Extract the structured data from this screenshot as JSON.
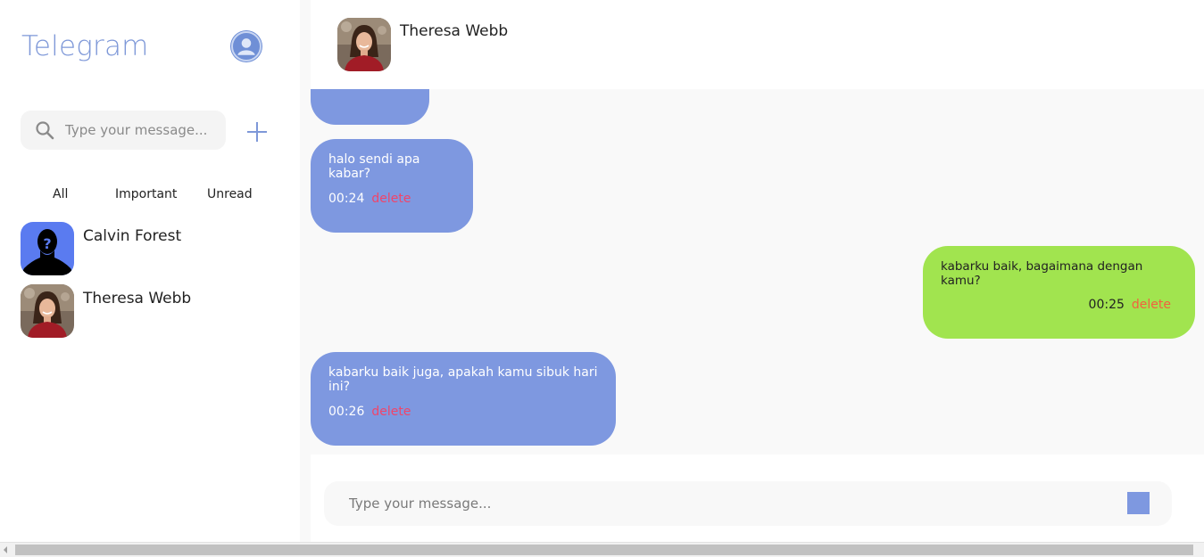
{
  "sidebar": {
    "title": "Telegram",
    "search": {
      "placeholder": "Type your message..."
    },
    "tabs": [
      {
        "label": "All"
      },
      {
        "label": "Important"
      },
      {
        "label": "Unread"
      }
    ],
    "contacts": [
      {
        "name": "Calvin Forest",
        "avatar": "unknown-person-avatar"
      },
      {
        "name": "Theresa Webb",
        "avatar": "photo-avatar"
      }
    ]
  },
  "chat": {
    "header": {
      "name": "Theresa Webb"
    },
    "messages": [
      {
        "direction": "in",
        "text": "",
        "time": "",
        "delete_label": ""
      },
      {
        "direction": "in",
        "text": "halo sendi apa kabar?",
        "time": "00:24",
        "delete_label": "delete"
      },
      {
        "direction": "out",
        "text": "kabarku baik, bagaimana dengan kamu?",
        "time": "00:25",
        "delete_label": "delete"
      },
      {
        "direction": "in",
        "text": "kabarku baik juga, apakah kamu sibuk hari ini?",
        "time": "00:26",
        "delete_label": "delete"
      }
    ],
    "composer": {
      "placeholder": "Type your message..."
    }
  },
  "colors": {
    "accent": "#7e98e0",
    "outgoing_bubble": "#a1e44f",
    "delete_in": "#f0456a",
    "delete_out": "#f2613f"
  }
}
